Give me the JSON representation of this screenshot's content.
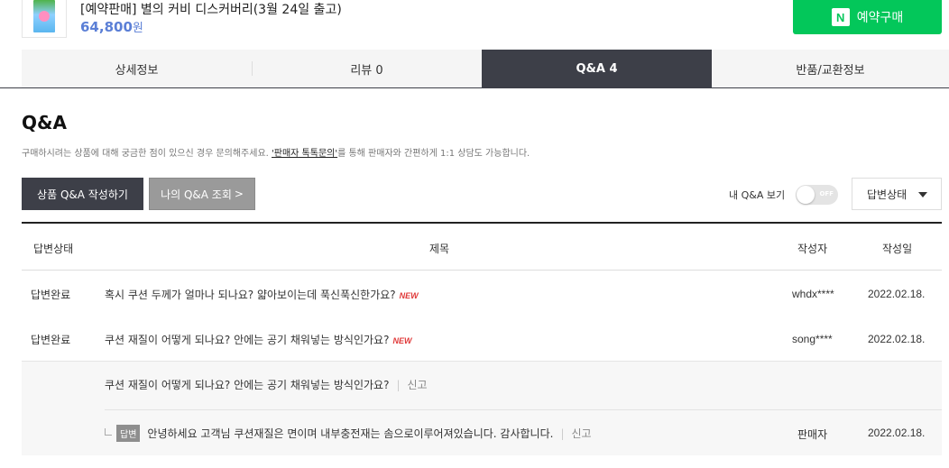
{
  "product": {
    "title": "[예약판매] 별의 커비 디스커버리(3월 24일 출고)",
    "price": "64,800",
    "price_unit": "원"
  },
  "npay_button": {
    "logo": "N",
    "label": "예약구매",
    "color": "#03c75a"
  },
  "tabs": [
    {
      "label": "상세정보",
      "active": false
    },
    {
      "label": "리뷰 0",
      "active": false
    },
    {
      "label": "Q&A 4",
      "active": true
    },
    {
      "label": "반품/교환정보",
      "active": false
    }
  ],
  "qa": {
    "title": "Q&A",
    "desc_before": "구매하시려는 상품에 대해 궁금한 점이 있으신 경우 문의해주세요. ",
    "desc_link": "'판매자 톡톡문의'",
    "desc_after": "를 통해 판매자와 간편하게 1:1 상담도 가능합니다.",
    "write_button": "상품 Q&A 작성하기",
    "my_button": "나의 Q&A 조회",
    "my_button_arrow": ">",
    "my_toggle_label": "내 Q&A 보기",
    "toggle_state": "OFF",
    "filter_select": "답변상태"
  },
  "table": {
    "headers": {
      "status": "답변상태",
      "title": "제목",
      "author": "작성자",
      "date": "작성일"
    },
    "rows": [
      {
        "status": "답변완료",
        "title": "혹시 쿠션 두께가 얼마나 되나요? 얇아보이는데 푹신푹신한가요?",
        "new": "NEW",
        "author": "whdx****",
        "date": "2022.02.18."
      },
      {
        "status": "답변완료",
        "title": "쿠션 재질이 어떻게 되나요? 안에는 공기 채워넣는 방식인가요?",
        "new": "NEW",
        "author": "song****",
        "date": "2022.02.18."
      }
    ],
    "expanded": {
      "question": "쿠션 재질이 어떻게 되나요? 안에는 공기 채워넣는 방식인가요?",
      "report": "신고",
      "answer_badge": "답변",
      "answer": "안녕하세요 고객님 쿠션재질은 면이며 내부충전재는 솜으로이루어져있습니다. 감사합니다.",
      "answer_report": "신고",
      "answer_author": "판매자",
      "answer_date": "2022.02.18."
    }
  },
  "colors": {
    "accent": "#3d3f48",
    "price": "#5b7fd6",
    "new": "#e03a3a"
  }
}
